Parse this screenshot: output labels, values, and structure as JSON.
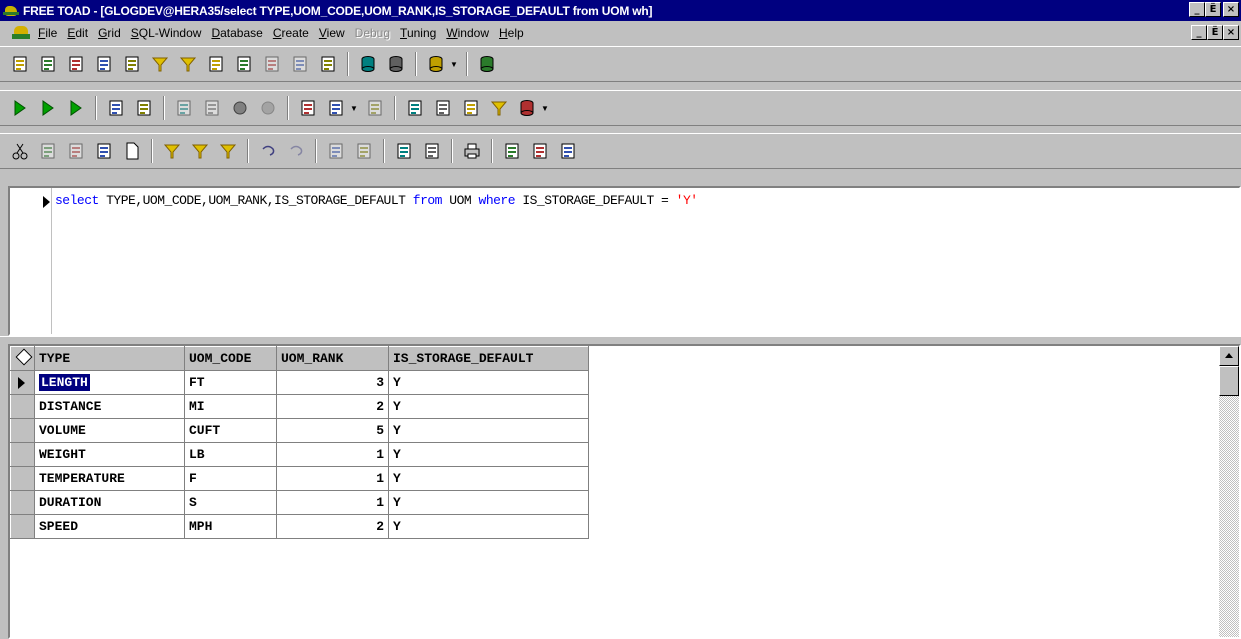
{
  "window": {
    "title": "FREE TOAD - [GLOGDEV@HERA35/select TYPE,UOM_CODE,UOM_RANK,IS_STORAGE_DEFAULT from UOM wh]",
    "minimize": "_",
    "restore": "Ё",
    "close": "×"
  },
  "menu": {
    "items": [
      {
        "label": "File",
        "u": "F",
        "rest": "ile"
      },
      {
        "label": "Edit",
        "u": "E",
        "rest": "dit"
      },
      {
        "label": "Grid",
        "u": "G",
        "rest": "rid"
      },
      {
        "label": "SQL-Window",
        "u": "S",
        "rest": "QL-Window"
      },
      {
        "label": "Database",
        "u": "D",
        "rest": "atabase"
      },
      {
        "label": "Create",
        "u": "C",
        "rest": "reate"
      },
      {
        "label": "View",
        "u": "V",
        "rest": "iew"
      },
      {
        "label": "Debug",
        "u": "",
        "rest": "Debug"
      },
      {
        "label": "Tuning",
        "u": "T",
        "rest": "uning"
      },
      {
        "label": "Window",
        "u": "W",
        "rest": "indow"
      },
      {
        "label": "Help",
        "u": "H",
        "rest": "elp"
      }
    ]
  },
  "toolbars": {
    "row1": [
      "sql-editor-icon",
      "schema-browser-icon",
      "procedure-editor-icon",
      "sql-modeler-icon",
      "report-icon",
      "funnel-icon",
      "funnel-advanced-icon",
      "data-export-icon",
      "script-icon",
      "document-icon",
      "options-icon",
      "wand-icon",
      "db-import-icon",
      "db-export-icon",
      "server-icon",
      "db-gold-icon"
    ],
    "row2": [
      "execute-icon",
      "execute-script-icon",
      "execute-current-icon",
      "step-icon",
      "explain-plan-icon",
      "indent-icon",
      "outdent-icon",
      "record-icon",
      "stop-icon",
      "open-file-icon",
      "load-icon",
      "save-icon",
      "vb-icon",
      "vb-stub-icon",
      "mail-icon",
      "filter-icon",
      "connect-icon"
    ],
    "row3": [
      "cut-icon",
      "copy-icon",
      "paste-icon",
      "paste-special-icon",
      "new-icon",
      "filter-funnel-icon",
      "filter-clear-icon",
      "filter-ab-icon",
      "undo-icon",
      "redo-icon",
      "uppercase-icon",
      "lowercase-icon",
      "indent-block-icon",
      "outdent-block-icon",
      "print-icon",
      "find-icon",
      "replace-icon",
      "help-icon"
    ]
  },
  "editor": {
    "kw_select": "select",
    "cols": " TYPE,UOM_CODE,UOM_RANK,IS_STORAGE_DEFAULT ",
    "kw_from": "from",
    "table": " UOM ",
    "kw_where": "where",
    "cond": " IS_STORAGE_DEFAULT = ",
    "literal": "'Y'"
  },
  "grid": {
    "columns": [
      "TYPE",
      "UOM_CODE",
      "UOM_RANK",
      "IS_STORAGE_DEFAULT"
    ],
    "rows": [
      {
        "type": "LENGTH",
        "uom_code": "FT",
        "uom_rank": "3",
        "is_storage_default": "Y"
      },
      {
        "type": "DISTANCE",
        "uom_code": "MI",
        "uom_rank": "2",
        "is_storage_default": "Y"
      },
      {
        "type": "VOLUME",
        "uom_code": "CUFT",
        "uom_rank": "5",
        "is_storage_default": "Y"
      },
      {
        "type": "WEIGHT",
        "uom_code": "LB",
        "uom_rank": "1",
        "is_storage_default": "Y"
      },
      {
        "type": "TEMPERATURE",
        "uom_code": "F",
        "uom_rank": "1",
        "is_storage_default": "Y"
      },
      {
        "type": "DURATION",
        "uom_code": "S",
        "uom_rank": "1",
        "is_storage_default": "Y"
      },
      {
        "type": "SPEED",
        "uom_code": "MPH",
        "uom_rank": "2",
        "is_storage_default": "Y"
      }
    ],
    "selected_row": 0
  },
  "colors": {
    "title_bg": "#000080",
    "face": "#c0c0c0",
    "keyword": "#0000ff",
    "string": "#ff0000",
    "selection": "#000080"
  }
}
